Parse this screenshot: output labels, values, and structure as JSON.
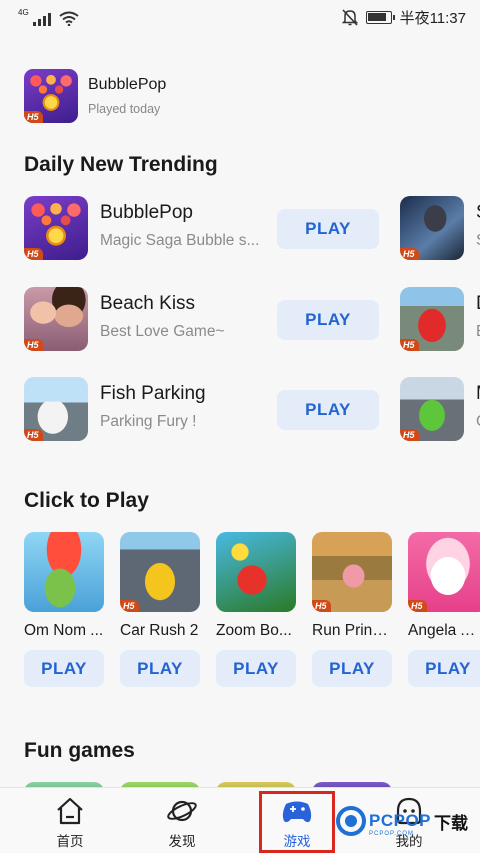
{
  "status_bar": {
    "network": "4G",
    "time": "半夜11:37",
    "battery_level": 0.85
  },
  "recent": {
    "name": "BubblePop",
    "subtitle": "Played today",
    "badge": "H5"
  },
  "daily_trending": {
    "title": "Daily New Trending",
    "rows": [
      {
        "name": "BubblePop",
        "subtitle": "Magic Saga Bubble s...",
        "play": "PLAY",
        "badge": "H5",
        "next_badge": "H5",
        "next_name": "S",
        "next_sub": "S"
      },
      {
        "name": "Beach Kiss",
        "subtitle": "Best Love Game~",
        "play": "PLAY",
        "badge": "H5",
        "next_badge": "H5",
        "next_name": "D",
        "next_sub": "E"
      },
      {
        "name": "Fish Parking",
        "subtitle": "Parking Fury !",
        "play": "PLAY",
        "badge": "H5",
        "next_badge": "H5",
        "next_name": "M",
        "next_sub": "C"
      }
    ]
  },
  "click_to_play": {
    "title": "Click to Play",
    "items": [
      {
        "name": "Om Nom ...",
        "play": "PLAY",
        "badge": ""
      },
      {
        "name": "Car Rush 2",
        "play": "PLAY",
        "badge": "H5"
      },
      {
        "name": "Zoom Bo...",
        "play": "PLAY",
        "badge": ""
      },
      {
        "name": "Run Princ...",
        "play": "PLAY",
        "badge": "H5"
      },
      {
        "name": "Angela Al...",
        "play": "PLAY",
        "badge": "H5"
      }
    ]
  },
  "fun_games": {
    "title": "Fun games"
  },
  "bottom_nav": {
    "items": [
      {
        "label": "首页",
        "icon": "home-icon"
      },
      {
        "label": "发现",
        "icon": "planet-icon"
      },
      {
        "label": "游戏",
        "icon": "gamepad-icon",
        "active": true
      },
      {
        "label": "我的",
        "icon": "profile-icon"
      }
    ]
  },
  "watermark": {
    "brand": "PCPOP",
    "cn": "下载",
    "sub": "PCPOP.COM"
  },
  "colors": {
    "accent": "#2264d1",
    "play_bg": "#e3ecf8",
    "highlight": "#d9271e",
    "h5_badge": "#d04a18"
  }
}
